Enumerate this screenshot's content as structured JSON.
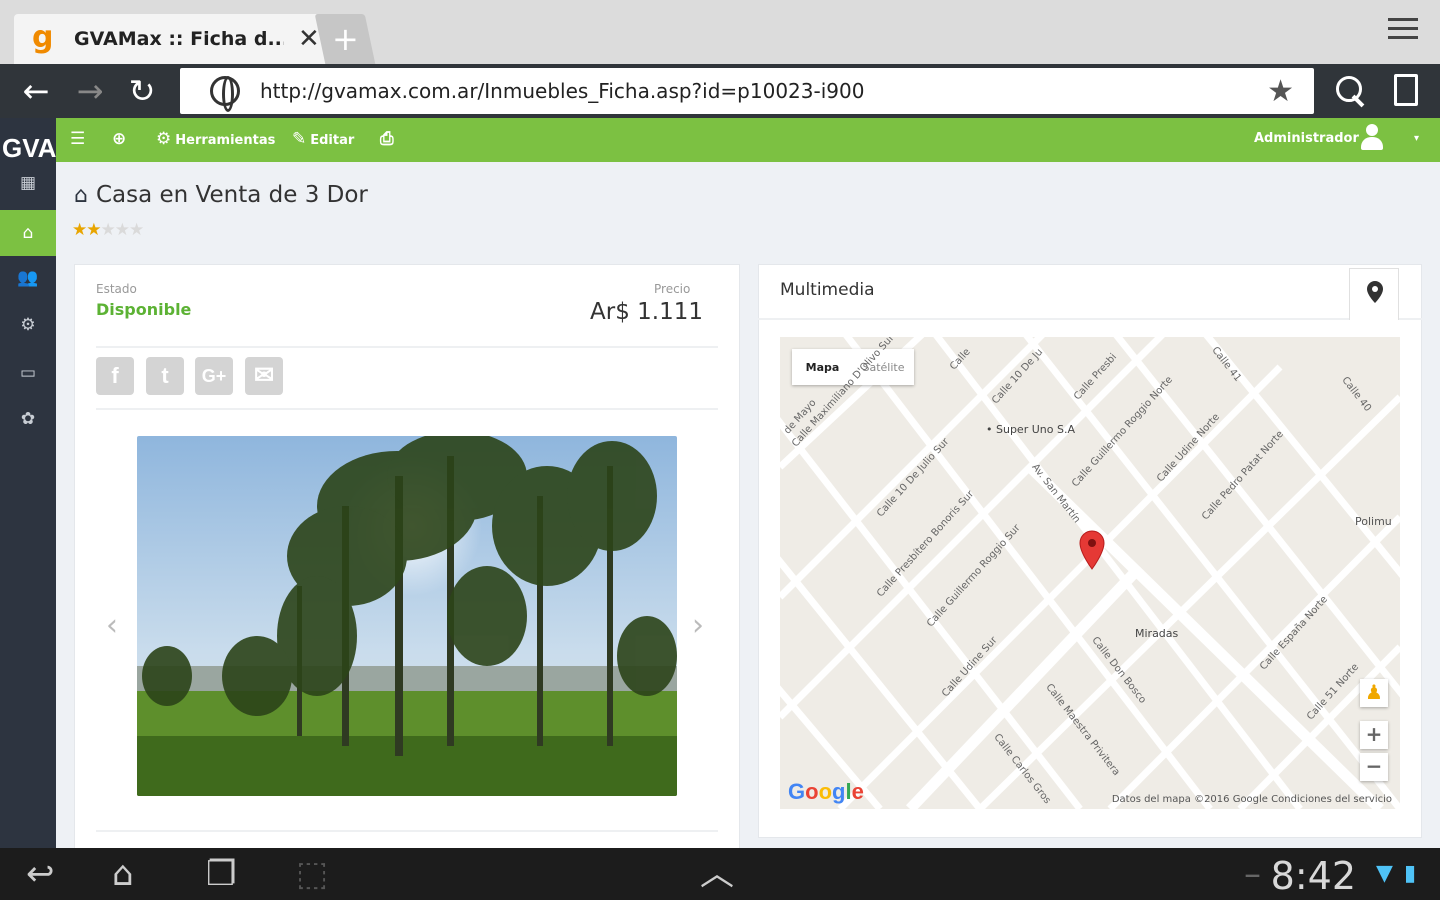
{
  "browser": {
    "tab_title": "GVAMax :: Ficha d...",
    "tab_favicon": "g",
    "close_tab": "✕",
    "new_tab": "+",
    "url": "http://gvamax.com.ar/Inmuebles_Ficha.asp?id=p10023-i900"
  },
  "app": {
    "logo": "GVA",
    "accent_color": "#7cc142",
    "sidebar_dark": "#2d3440",
    "toolbar": {
      "herramientas": "Herramientas",
      "editar": "Editar",
      "user": "Administrador"
    },
    "sidebar_icons": [
      "dashboard-icon",
      "home-icon",
      "users-icon",
      "tags-icon",
      "calendar-icon",
      "settings-icon"
    ]
  },
  "property": {
    "title": "Casa en Venta de 3 Dor",
    "rating": 2,
    "rating_max": 5,
    "status_label": "Estado",
    "status_value": "Disponible",
    "price_label": "Precio",
    "price_value": "Ar$ 1.111",
    "share_icons": [
      "facebook-icon",
      "twitter-icon",
      "google-plus-icon",
      "email-icon"
    ]
  },
  "multimedia": {
    "title": "Multimedia",
    "map_type_map": "Mapa",
    "map_type_satellite": "Satélite",
    "zoom_in": "+",
    "zoom_out": "−",
    "google": "Google",
    "terms": "Datos del mapa ©2016 Google    Condiciones del servicio",
    "map_labels": {
      "super_uno": "Super Uno S.A",
      "miradas": "Miradas",
      "polimu": "Polimu",
      "calle_10_julio": "Calle 10 De Julio Sur",
      "calle_maximiliano": "Calle Maximiliano D'Olivo Sur",
      "calle_bonoris": "Calle Presbítero Bonoris Sur",
      "calle_guillermo_sur": "Calle Guillermo Roggio Sur",
      "calle_udine_sur": "Calle Udine Sur",
      "av_san_martin": "Av. San Martín",
      "calle_guillermo_norte": "Calle Guillermo Roggio Norte",
      "calle_udine_norte": "Calle Udine Norte",
      "calle_pedro_patat": "Calle Pedro Patat Norte",
      "calle_espana": "Calle España Norte",
      "calle_51_norte": "Calle 51 Norte",
      "calle_don_bosco": "Calle Don Bosco",
      "calle_maestra": "Calle Maestra Privitera",
      "calle_carlos": "Calle Carlos Gros",
      "calle_41": "Calle 41",
      "calle_40": "Calle 40",
      "calle_10_de": "Calle 10 De Ju",
      "calle_presbi": "Calle Presbi",
      "calle_mayo": "de Mayo",
      "calle_corner": "Calle"
    }
  },
  "system": {
    "time": "8:42"
  }
}
